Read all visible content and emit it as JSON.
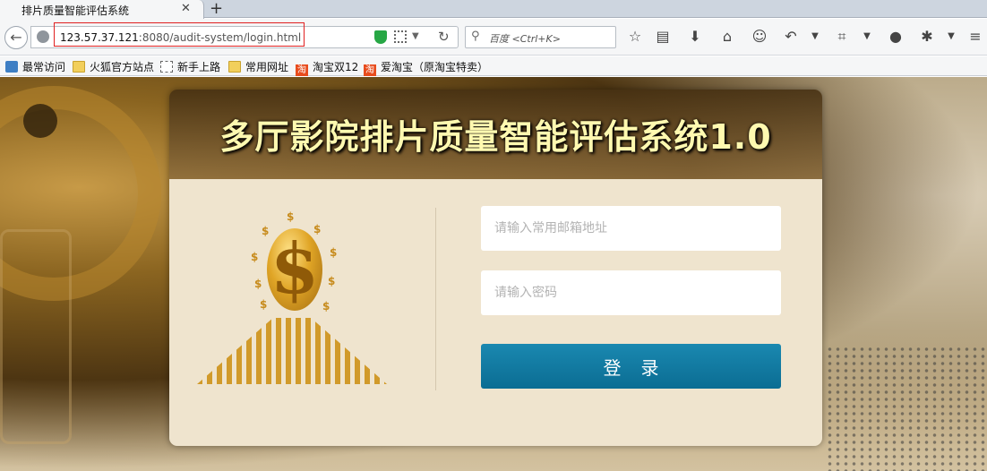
{
  "browser": {
    "tab": {
      "title": "排片质量智能评估系统"
    },
    "address": {
      "host": "123.57.37.121",
      "path": ":8080/audit-system/login.html"
    },
    "search": {
      "placeholder": "百度 <Ctrl+K>"
    },
    "bookmarks": [
      {
        "label": "最常访问",
        "icon": "most-visited-icon"
      },
      {
        "label": "火狐官方站点",
        "icon": "folder-icon"
      },
      {
        "label": "新手上路",
        "icon": "page-icon"
      },
      {
        "label": "常用网址",
        "icon": "folder-icon"
      },
      {
        "label": "淘宝双12",
        "icon": "taobao-icon"
      },
      {
        "label": "爱淘宝（原淘宝特卖）",
        "icon": "taobao-icon"
      }
    ],
    "taobao_glyph": "淘",
    "toolbar_icons": [
      "star-icon",
      "library-icon",
      "download-icon",
      "home-icon",
      "chat-icon",
      "undo-icon",
      "crop-icon",
      "speech-icon",
      "bug-icon",
      "menu-icon"
    ]
  },
  "login": {
    "title": "多厅影院排片质量智能评估系统1.0",
    "email_placeholder": "请输入常用邮箱地址",
    "password_placeholder": "请输入密码",
    "button_label": "登录"
  },
  "colors": {
    "button": "#0b7aa2",
    "title_text": "#fff9b0",
    "card_body": "#efe4ce",
    "url_highlight_border": "#e02020"
  }
}
